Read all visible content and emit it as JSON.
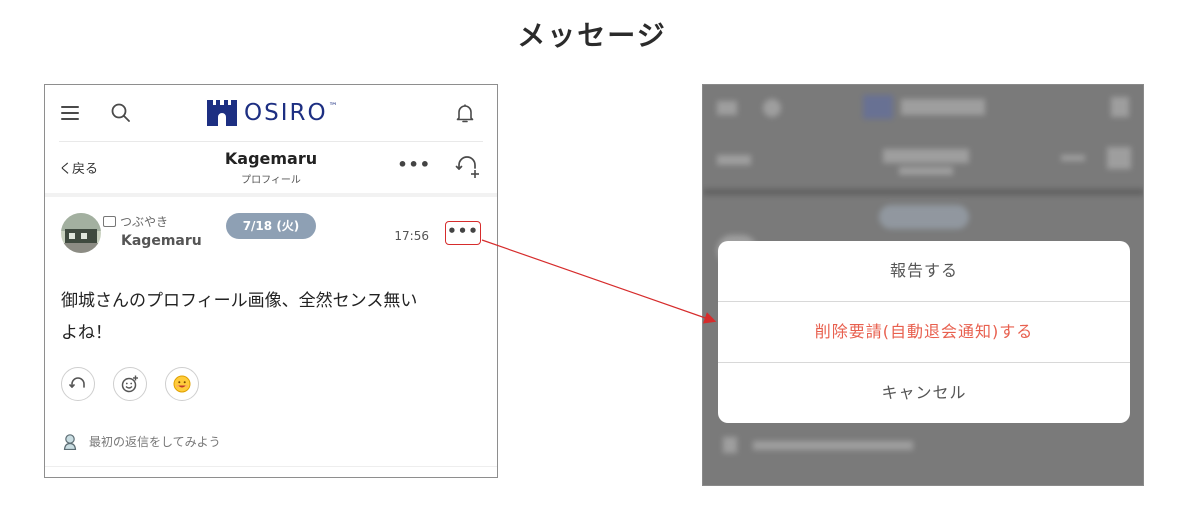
{
  "page_title": "メッセージ",
  "colors": {
    "brand": "#1d2f82",
    "date_pill": "#8ea0b4",
    "highlight": "#d62c2c",
    "danger_text": "#e8604f",
    "smile": "#ffcc3a"
  },
  "header": {
    "logo_text": "OSIRO",
    "logo_tm": "™"
  },
  "subbar": {
    "back_label": "く戻る",
    "title": "Kagemaru",
    "subtitle": "プロフィール",
    "more_label": "•••"
  },
  "post": {
    "type_label": "つぶやき",
    "author": "Kagemaru",
    "date": "7/18 (火)",
    "time": "17:56",
    "menu_label": "•••",
    "body_line1": "御城さんのプロフィール画像、全然センス無い",
    "body_line2": "よね！",
    "first_reply_prompt": "最初の返信をしてみよう",
    "reaction_icons": [
      "reply-icon",
      "add-emoji-icon",
      "smile-icon"
    ]
  },
  "action_sheet": {
    "report": "報告する",
    "delete_request": "削除要請(自動退会通知)する",
    "cancel": "キャンセル"
  }
}
